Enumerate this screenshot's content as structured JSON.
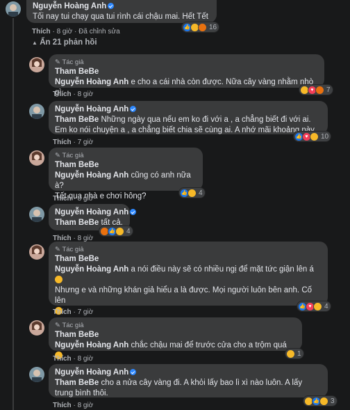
{
  "top_comment": {
    "author": "Nguyễn Hoàng Anh",
    "text": "Tối nay tui chạy qua tui rình cái chậu mai. Hết Tết",
    "like_label": "Thích",
    "time": "8 giờ",
    "edited": "Đã chỉnh sửa",
    "reaction_count": "16"
  },
  "hide_replies_label": "Ẩn 21 phản hồi",
  "replies": [
    {
      "author_tag": "Tác giả",
      "author": "Tham BeBe",
      "mention": "Nguyễn Hoàng Anh",
      "text": " e cho a cái nhà còn được. Nữa cây vàng nhằm nhò gì",
      "like_label": "Thích",
      "time": "8 giờ",
      "reaction_count": "7"
    },
    {
      "author": "Nguyễn Hoàng Anh",
      "mention": "Tham BeBe",
      "text": " Những ngày qua nếu em ko đi với a , a chẳng biết đi với ai. Em ko nói chuyện a , a chẳng biết chia sẽ cùng ai. A nhớ mãi khoảng này.",
      "like_label": "Thích",
      "time": "7 giờ",
      "reaction_count": "10"
    },
    {
      "author_tag": "Tác giả",
      "author": "Tham BeBe",
      "mention": "Nguyễn Hoàng Anh",
      "text": " cũng có anh nữa à?",
      "text2": "Tết qua nhà e chơi hông?",
      "like_label": "Thích",
      "time": "8 giờ",
      "reaction_count": "4"
    },
    {
      "author": "Nguyễn Hoàng Anh",
      "mention": "Tham BeBe",
      "text": " tất cả.",
      "like_label": "Thích",
      "time": "8 giờ",
      "reaction_count": "4"
    },
    {
      "author_tag": "Tác giả",
      "author": "Tham BeBe",
      "mention": "Nguyễn Hoàng Anh",
      "text": " a nói điều này sẽ có nhiều ngị để mặt tức giận lên á",
      "text2": "Nhưng e và những khán giả hiểu a là được. Mọi người luôn bên anh. Cố lên",
      "like_label": "Thích",
      "time": "7 giờ",
      "reaction_count": "4"
    },
    {
      "author_tag": "Tác giả",
      "author": "Tham BeBe",
      "mention": "Nguyễn Hoàng Anh",
      "text": " chắc chậu mai để trước cửa cho a trộm quá",
      "like_label": "Thích",
      "time": "8 giờ",
      "reaction_count": "1"
    },
    {
      "author": "Nguyễn Hoàng Anh",
      "mention": "Tham BeBe",
      "text": " cho a nửa cây vàng đi. A khỏi lấy bao lì xì nào luôn. A lấy trung bình thôi.",
      "like_label": "Thích",
      "time": "8 giờ",
      "reaction_count": "3"
    }
  ],
  "colors": {
    "background": "#18191a",
    "bubble": "#3a3b3c",
    "text": "#e4e6eb",
    "meta": "#b0b3b8",
    "like_blue": "#1877f2",
    "haha_yellow": "#f7b928"
  }
}
